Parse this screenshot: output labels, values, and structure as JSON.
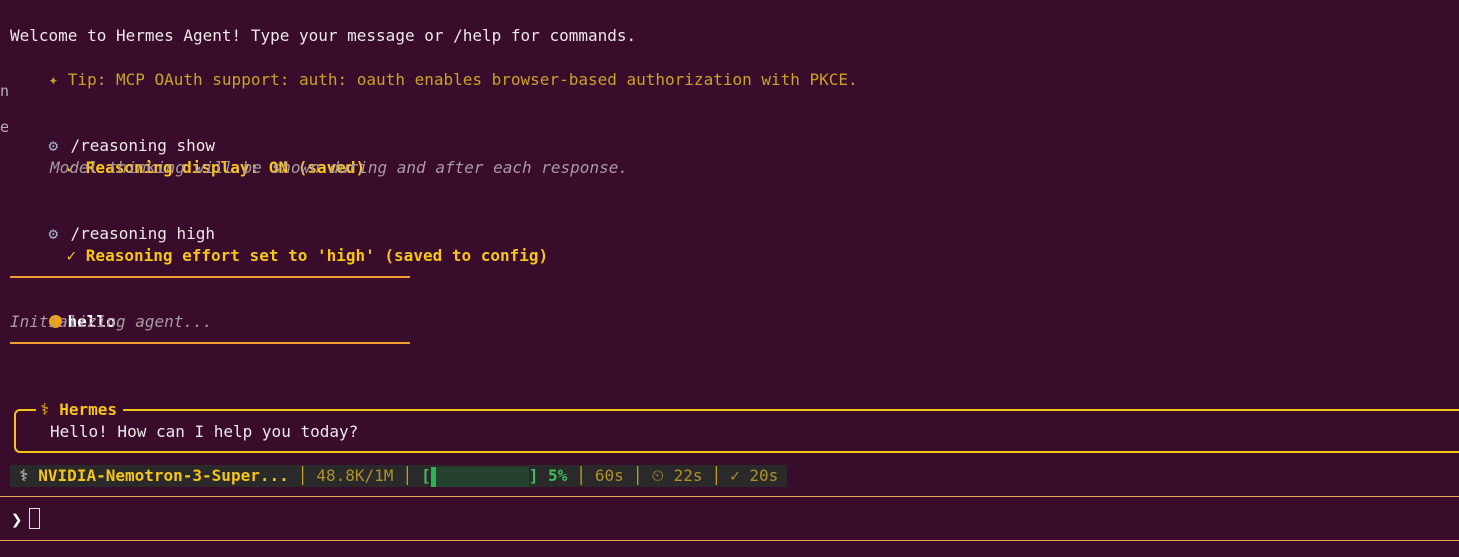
{
  "colors": {
    "background": "#380c2a",
    "accent_gold": "#f5c518",
    "rule_orange": "#f0a030",
    "progress_green": "#2fb35a"
  },
  "edge_fragments": [
    "n",
    "ef"
  ],
  "welcome": {
    "text": "Welcome to Hermes Agent! Type your message or /help for commands.",
    "tip_icon": "sparkle-icon",
    "tip_text": "✦ Tip: MCP OAuth support: auth: oauth enables browser-based authorization with PKCE."
  },
  "commands": [
    {
      "icon": "gear-icon",
      "command": "/reasoning show",
      "result": "✓ Reasoning display: ON (saved)",
      "detail": "Model thinking will be shown during and after each response."
    },
    {
      "icon": "gear-icon",
      "command": "/reasoning high",
      "result": "✓ Reasoning effort set to 'high' (saved to config)"
    }
  ],
  "user_turn": {
    "message": "hello",
    "status": "Initializing agent..."
  },
  "response": {
    "title": "⚕ Hermes",
    "text": "Hello! How can I help you today?"
  },
  "status_bar": {
    "model_icon": "⚕",
    "model": "NVIDIA-Nemotron-3-Super...",
    "tokens": "48.8K/1M",
    "context_fraction": 0.05,
    "bracket_open": "[",
    "bracket_close": "]",
    "context_percent": "5%",
    "timeout": "60s",
    "elapsed": "⏲ 22s",
    "completed": "✓ 20s"
  },
  "prompt": {
    "symbol": "❯",
    "input_value": ""
  }
}
